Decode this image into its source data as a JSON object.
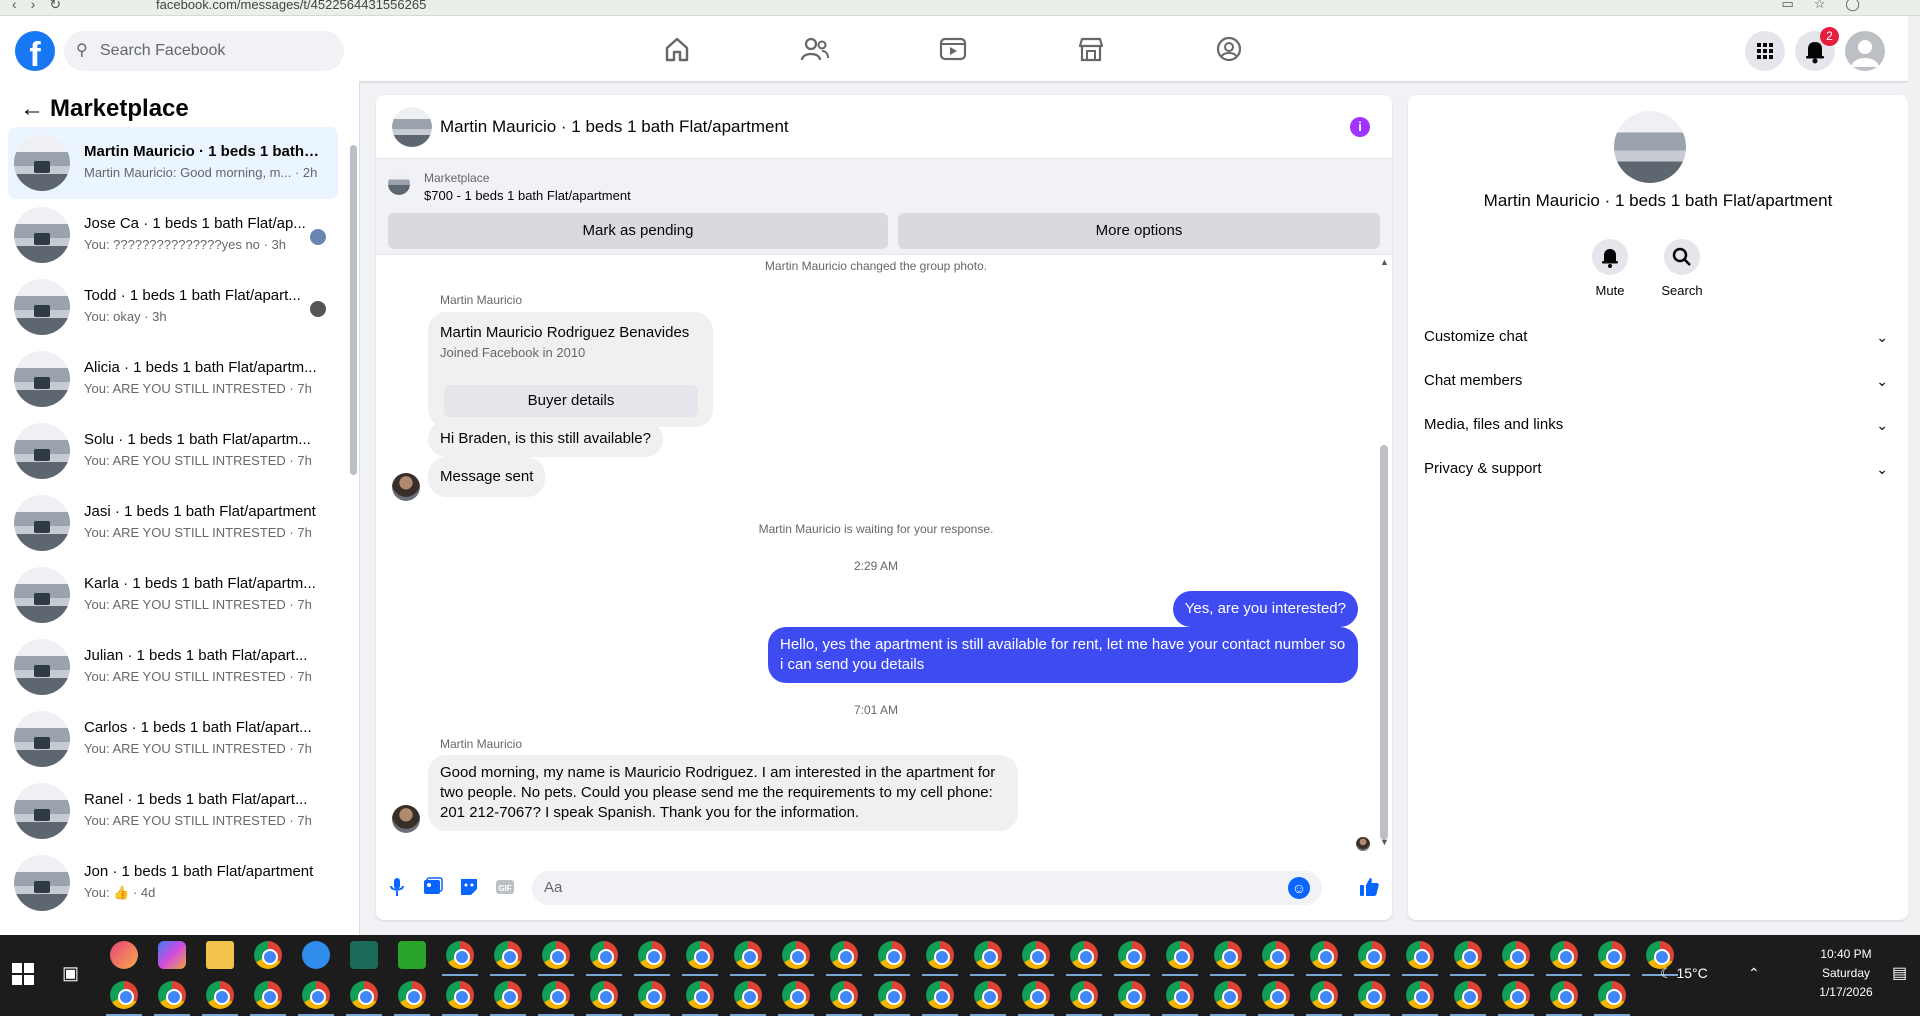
{
  "browser": {
    "url": "facebook.com/messages/t/4522564431556265"
  },
  "topbar": {
    "search_placeholder": "Search Facebook",
    "notification_count": "2"
  },
  "sidebar": {
    "title": "Marketplace",
    "conversations": [
      {
        "title": "Martin Mauricio · 1 beds 1 bath ...",
        "subtitle": "Martin Mauricio: Good morning, m... · 2h"
      },
      {
        "title": "Jose Ca · 1 beds 1 bath Flat/ap...",
        "subtitle": "You: ???????????????yes no · 3h"
      },
      {
        "title": "Todd · 1 beds 1 bath Flat/apart...",
        "subtitle": "You: okay · 3h"
      },
      {
        "title": "Alicia · 1 beds 1 bath Flat/apartm...",
        "subtitle": "You: ARE YOU STILL INTRESTED · 7h"
      },
      {
        "title": "Solu · 1 beds 1 bath Flat/apartm...",
        "subtitle": "You: ARE YOU STILL INTRESTED · 7h"
      },
      {
        "title": "Jasi · 1 beds 1 bath Flat/apartment",
        "subtitle": "You: ARE YOU STILL INTRESTED · 7h"
      },
      {
        "title": "Karla · 1 beds 1 bath Flat/apartm...",
        "subtitle": "You: ARE YOU STILL INTRESTED · 7h"
      },
      {
        "title": "Julian · 1 beds 1 bath Flat/apart...",
        "subtitle": "You: ARE YOU STILL INTRESTED · 7h"
      },
      {
        "title": "Carlos · 1 beds 1 bath Flat/apart...",
        "subtitle": "You: ARE YOU STILL INTRESTED · 7h"
      },
      {
        "title": "Ranel · 1 beds 1 bath Flat/apart...",
        "subtitle": "You: ARE YOU STILL INTRESTED · 7h"
      },
      {
        "title": "Jon · 1 beds 1 bath Flat/apartment",
        "subtitle": "You: 👍 · 4d"
      }
    ]
  },
  "chat": {
    "title": "Martin Mauricio · 1 beds 1 bath Flat/apartment",
    "marketplace_label": "Marketplace",
    "listing": "$700 - 1 beds 1 bath Flat/apartment",
    "mark_pending": "Mark as pending",
    "more_options": "More options",
    "sys_photo": "Martin Mauricio changed the group photo.",
    "sender1": "Martin Mauricio",
    "card_name": "Martin Mauricio Rodriguez Benavides",
    "card_joined": "Joined Facebook in 2010",
    "card_button": "Buyer details",
    "msg_available": "Hi Braden, is this still available?",
    "msg_sent": "Message sent",
    "sys_waiting": "Martin Mauricio is waiting for your response.",
    "time1": "2:29 AM",
    "out1": "Yes, are you interested?",
    "out2": "Hello, yes the apartment is still available for rent, let me have your contact number so i can send you details",
    "time2": "7:01 AM",
    "sender2": "Martin Mauricio",
    "in_long": "Good morning, my name is Mauricio Rodriguez. I am interested in the apartment for two people. No pets. Could you please send me the requirements to my cell phone: 201 212-7067? I speak Spanish. Thank you for the information.",
    "composer_placeholder": "Aa"
  },
  "info": {
    "name": "Martin Mauricio · 1 beds 1 bath Flat/apartment",
    "mute": "Mute",
    "search": "Search",
    "sections": [
      "Customize chat",
      "Chat members",
      "Media, files and links",
      "Privacy & support"
    ]
  },
  "taskbar": {
    "temperature": "15°C",
    "time": "10:40 PM",
    "day": "Saturday",
    "date": "1/17/2026"
  }
}
